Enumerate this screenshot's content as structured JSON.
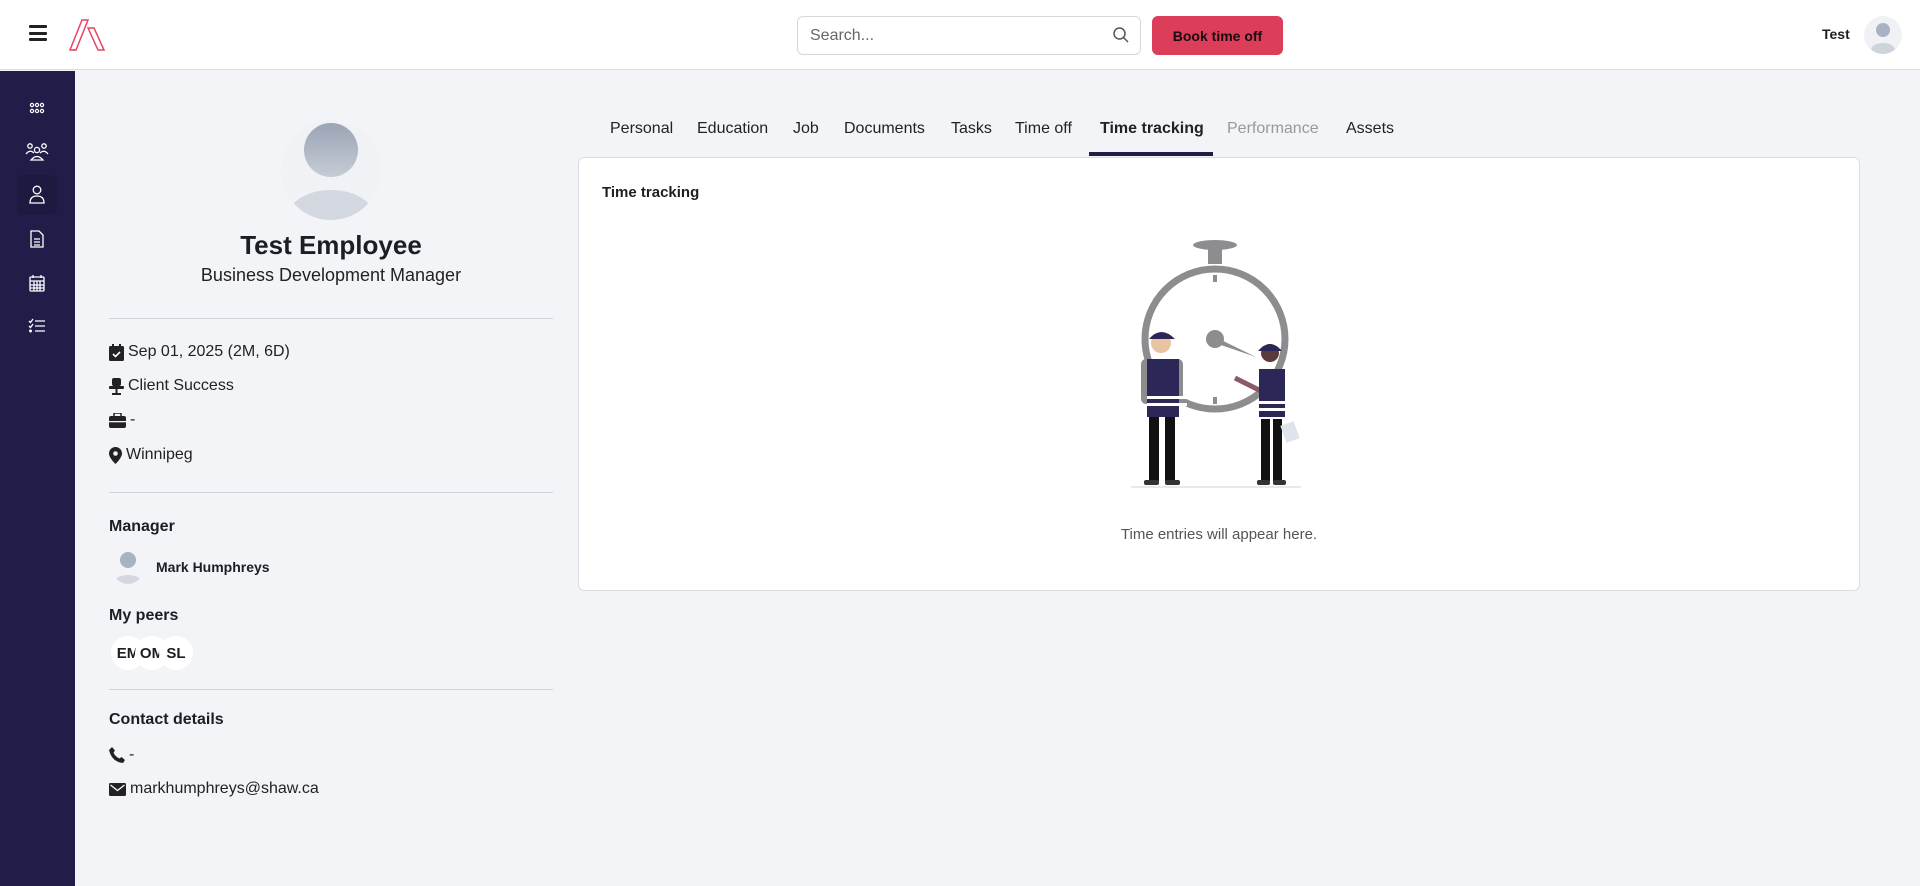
{
  "header": {
    "search_placeholder": "Search...",
    "book_label": "Book time off",
    "user_name": "Test"
  },
  "sidebar": {
    "items": [
      {
        "icon": "apps-icon"
      },
      {
        "icon": "team-icon"
      },
      {
        "icon": "person-icon",
        "active": true
      },
      {
        "icon": "document-icon"
      },
      {
        "icon": "calendar-icon"
      },
      {
        "icon": "checklist-icon"
      }
    ]
  },
  "profile": {
    "name": "Test Employee",
    "title": "Business Development Manager",
    "start_date": "Sep 01, 2025 (2M, 6D)",
    "department": "Client Success",
    "job": "-",
    "location": "Winnipeg",
    "manager_heading": "Manager",
    "manager_name": "Mark Humphreys",
    "peers_heading": "My peers",
    "peers": [
      "EM",
      "OM",
      "SL"
    ],
    "contact_heading": "Contact details",
    "phone": "-",
    "email": "markhumphreys@shaw.ca"
  },
  "tabs": [
    "Personal",
    "Education",
    "Job",
    "Documents",
    "Tasks",
    "Time off",
    "Time tracking",
    "Performance",
    "Assets"
  ],
  "active_tab": "Time tracking",
  "card": {
    "title": "Time tracking",
    "empty_text": "Time entries will appear here."
  },
  "colors": {
    "brand": "#dc3d58",
    "sidebar": "#221d48",
    "background": "#f3f4f8"
  }
}
